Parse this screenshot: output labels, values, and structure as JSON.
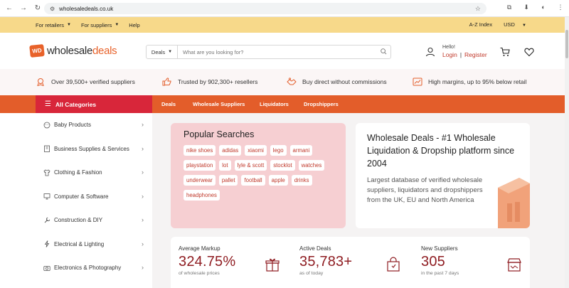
{
  "browser": {
    "url": "wholesaledeals.co.uk"
  },
  "topbar": {
    "retailers": "For retailers",
    "suppliers": "For suppliers",
    "help": "Help",
    "az_index": "A-Z Index",
    "currency": "USD"
  },
  "header": {
    "logo_mark": "WD",
    "logo_word_1": "wholesale",
    "logo_word_2": "deals",
    "search_dropdown": "Deals",
    "search_placeholder": "What are you looking for?",
    "hello": "Hello!",
    "login": "Login",
    "separator": "|",
    "register": "Register"
  },
  "trust": [
    "Over 39,500+ verified suppliers",
    "Trusted by 902,300+ resellers",
    "Buy direct without commissions",
    "High margins, up to 95% below retail"
  ],
  "catnav": {
    "all_categories": "All Categories",
    "links": [
      "Deals",
      "Wholesale Suppliers",
      "Liquidators",
      "Dropshippers"
    ]
  },
  "sidebar": {
    "items": [
      "Baby Products",
      "Business Supplies & Services",
      "Clothing & Fashion",
      "Computer & Software",
      "Construction & DIY",
      "Electrical & Lighting",
      "Electronics & Photography"
    ]
  },
  "popular": {
    "title": "Popular Searches",
    "tags": [
      "nike shoes",
      "adidas",
      "xiaomi",
      "lego",
      "armani",
      "playstation",
      "lot",
      "lyle & scott",
      "stocklot",
      "watches",
      "underwear",
      "pallet",
      "football",
      "apple",
      "drinks",
      "headphones"
    ]
  },
  "hero": {
    "title": "Wholesale Deals - #1 Wholesale Liquidation & Dropship platform since 2004",
    "text": "Largest database of verified wholesale suppliers, liquidators and dropshippers from the UK, EU and North America"
  },
  "stats": [
    {
      "label": "Average Markup",
      "value": "324.75%",
      "sub": "of wholesale prices"
    },
    {
      "label": "Active Deals",
      "value": "35,783+",
      "sub": "as of today"
    },
    {
      "label": "New Suppliers",
      "value": "305",
      "sub": "in the past 7 days"
    }
  ],
  "colors": {
    "brand_orange": "#e35d2a",
    "brand_red": "#d8263a",
    "topbar_yellow": "#f7d98a",
    "stat_value": "#8f1d22"
  }
}
